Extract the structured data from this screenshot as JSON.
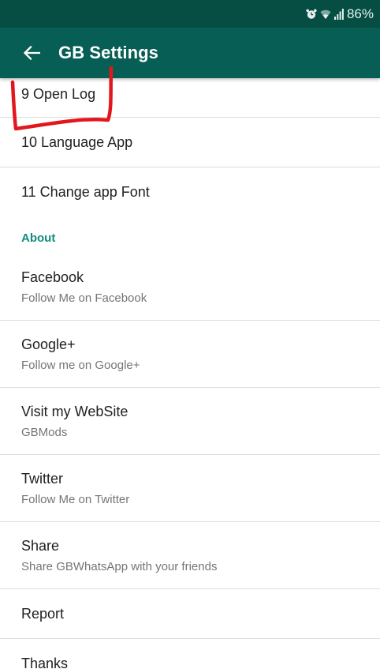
{
  "status_bar": {
    "battery": "86%",
    "icons": [
      "alarm-icon",
      "wifi-icon",
      "signal-icon"
    ]
  },
  "app_bar": {
    "title": "GB Settings",
    "back_icon": "arrow-left-icon"
  },
  "settings_items": [
    {
      "title": "9 Open Log"
    },
    {
      "title": "10 Language App"
    },
    {
      "title": "11 Change app Font"
    }
  ],
  "about_section": {
    "header": "About",
    "items": [
      {
        "title": "Facebook",
        "subtitle": "Follow Me on Facebook"
      },
      {
        "title": "Google+",
        "subtitle": "Follow me on Google+"
      },
      {
        "title": "Visit my WebSite",
        "subtitle": "GBMods"
      },
      {
        "title": "Twitter",
        "subtitle": "Follow Me on Twitter"
      },
      {
        "title": "Share",
        "subtitle": "Share GBWhatsApp with your friends"
      },
      {
        "title": "Report"
      },
      {
        "title": "Thanks"
      }
    ]
  },
  "colors": {
    "status_bar": "#064e43",
    "app_bar": "#075e54",
    "section_header": "#128c7e",
    "annotation": "#e3161e"
  }
}
